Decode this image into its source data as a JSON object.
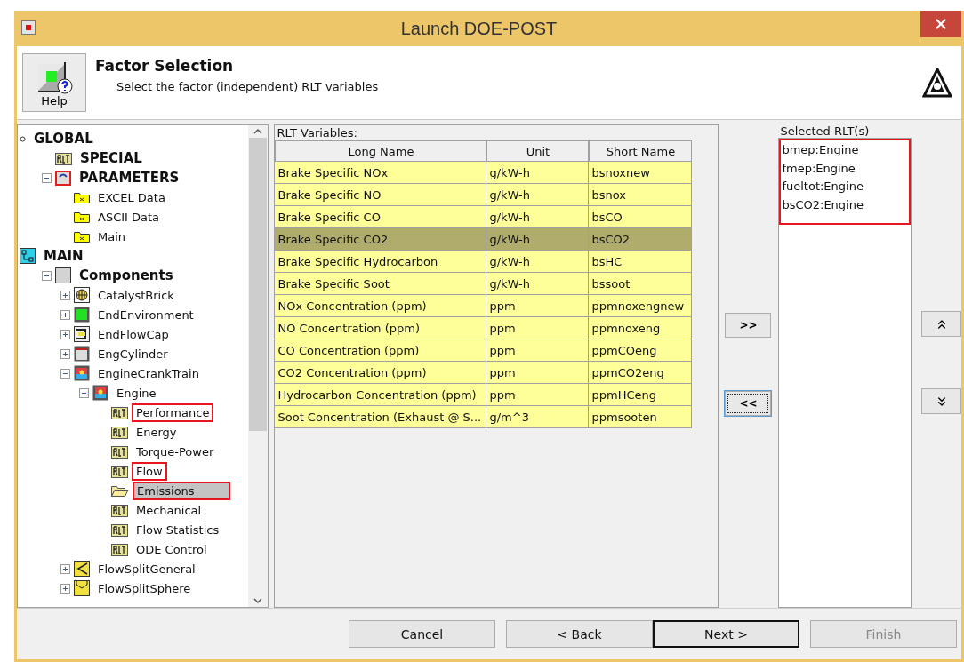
{
  "window": {
    "title": "Launch DOE-POST"
  },
  "header": {
    "help_button": "Help",
    "title": "Factor Selection",
    "subtitle": "Select the factor (independent) RLT variables"
  },
  "tree": [
    {
      "label": "GLOBAL",
      "kind": "dot",
      "children": [
        {
          "label": "SPECIAL",
          "kind": "rlt"
        },
        {
          "label": "PARAMETERS",
          "kind": "params",
          "expanded": true,
          "children": [
            {
              "label": "EXCEL Data",
              "kind": "folder"
            },
            {
              "label": "ASCII Data",
              "kind": "folder"
            },
            {
              "label": "Main",
              "kind": "folder"
            }
          ]
        }
      ]
    },
    {
      "label": "MAIN",
      "kind": "network",
      "children": [
        {
          "label": "Components",
          "kind": "box",
          "expanded": true,
          "children": [
            {
              "label": "CatalystBrick",
              "kind": "catalyst",
              "expanded": false
            },
            {
              "label": "EndEnvironment",
              "kind": "environment",
              "expanded": false
            },
            {
              "label": "EndFlowCap",
              "kind": "cap",
              "expanded": false
            },
            {
              "label": "EngCylinder",
              "kind": "cylinder",
              "expanded": false
            },
            {
              "label": "EngineCrankTrain",
              "kind": "engine",
              "expanded": true,
              "children": [
                {
                  "label": "Engine",
                  "kind": "engine",
                  "expanded": true,
                  "children": [
                    {
                      "label": "Performance",
                      "kind": "rlt",
                      "selected": false,
                      "highlighted": true
                    },
                    {
                      "label": "Energy",
                      "kind": "rlt",
                      "selected": false,
                      "highlighted": false
                    },
                    {
                      "label": "Torque-Power",
                      "kind": "rlt",
                      "selected": false,
                      "highlighted": false
                    },
                    {
                      "label": "Flow",
                      "kind": "rlt",
                      "selected": false,
                      "highlighted": true
                    },
                    {
                      "label": "Emissions",
                      "kind": "open-folder",
                      "selected": true,
                      "highlighted": true
                    },
                    {
                      "label": "Mechanical",
                      "kind": "rlt",
                      "selected": false,
                      "highlighted": false
                    },
                    {
                      "label": "Flow Statistics",
                      "kind": "rlt",
                      "selected": false,
                      "highlighted": false
                    },
                    {
                      "label": "ODE Control",
                      "kind": "rlt",
                      "selected": false,
                      "highlighted": false
                    }
                  ]
                }
              ]
            },
            {
              "label": "FlowSplitGeneral",
              "kind": "split",
              "expanded": false
            },
            {
              "label": "FlowSplitSphere",
              "kind": "sphere",
              "expanded": false
            }
          ]
        }
      ]
    }
  ],
  "table": {
    "label": "RLT Variables:",
    "columns": [
      "Long Name",
      "Unit",
      "Short Name"
    ],
    "rows": [
      {
        "cells": [
          "Brake Specific NOx",
          "g/kW-h",
          "bsnoxnew"
        ],
        "selected": false
      },
      {
        "cells": [
          "Brake Specific NO",
          "g/kW-h",
          "bsnox"
        ],
        "selected": false
      },
      {
        "cells": [
          "Brake Specific CO",
          "g/kW-h",
          "bsCO"
        ],
        "selected": false
      },
      {
        "cells": [
          "Brake Specific CO2",
          "g/kW-h",
          "bsCO2"
        ],
        "selected": true
      },
      {
        "cells": [
          "Brake Specific Hydrocarbon",
          "g/kW-h",
          "bsHC"
        ],
        "selected": false
      },
      {
        "cells": [
          "Brake Specific Soot",
          "g/kW-h",
          "bssoot"
        ],
        "selected": false
      },
      {
        "cells": [
          "NOx Concentration (ppm)",
          "ppm",
          "ppmnoxengnew"
        ],
        "selected": false
      },
      {
        "cells": [
          "NO Concentration (ppm)",
          "ppm",
          "ppmnoxeng"
        ],
        "selected": false
      },
      {
        "cells": [
          "CO Concentration (ppm)",
          "ppm",
          "ppmCOeng"
        ],
        "selected": false
      },
      {
        "cells": [
          "CO2 Concentration (ppm)",
          "ppm",
          "ppmCO2eng"
        ],
        "selected": false
      },
      {
        "cells": [
          "Hydrocarbon Concentration (ppm)",
          "ppm",
          "ppmHCeng"
        ],
        "selected": false
      },
      {
        "cells": [
          "Soot Concentration (Exhaust @ S...",
          "g/m^3",
          "ppmsooten"
        ],
        "selected": false
      }
    ]
  },
  "transfer_buttons": [
    {
      "label": ">>",
      "focused": false
    },
    {
      "label": "<<",
      "focused": true
    }
  ],
  "selected_list": {
    "label": "Selected RLT(s)",
    "highlighted": true,
    "items": [
      "bmep:Engine",
      "fmep:Engine",
      "fueltot:Engine",
      "bsCO2:Engine"
    ]
  },
  "order_buttons": [
    {
      "kind": "up"
    },
    {
      "kind": "down"
    }
  ],
  "footer_buttons": [
    {
      "label": "Cancel",
      "default": false,
      "disabled": false
    },
    {
      "label": "< Back",
      "default": false,
      "disabled": false
    },
    {
      "label": "Next >",
      "default": true,
      "disabled": false
    },
    {
      "label": "Finish",
      "default": false,
      "disabled": true
    }
  ]
}
